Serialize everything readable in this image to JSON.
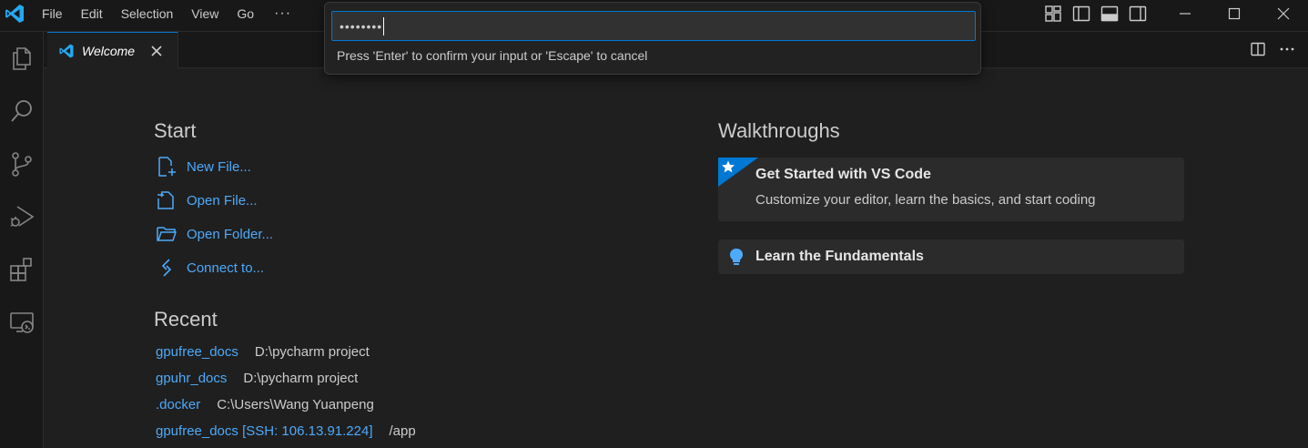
{
  "menu": {
    "items": [
      "File",
      "Edit",
      "Selection",
      "View",
      "Go"
    ],
    "more": "···"
  },
  "tab": {
    "label": "Welcome"
  },
  "quick_input": {
    "masked_value": "••••••••",
    "message": "Press 'Enter' to confirm your input or 'Escape' to cancel"
  },
  "start": {
    "title": "Start",
    "items": [
      {
        "label": "New File...",
        "icon": "new-file-icon"
      },
      {
        "label": "Open File...",
        "icon": "open-file-icon"
      },
      {
        "label": "Open Folder...",
        "icon": "open-folder-icon"
      },
      {
        "label": "Connect to...",
        "icon": "remote-connect-icon"
      }
    ]
  },
  "recent": {
    "title": "Recent",
    "items": [
      {
        "name": "gpufree_docs",
        "path": "D:\\pycharm project"
      },
      {
        "name": "gpuhr_docs",
        "path": "D:\\pycharm project"
      },
      {
        "name": ".docker",
        "path": "C:\\Users\\Wang Yuanpeng"
      },
      {
        "name": "gpufree_docs [SSH: 106.13.91.224]",
        "path": "/app"
      }
    ]
  },
  "walkthroughs": {
    "title": "Walkthroughs",
    "items": [
      {
        "title": "Get Started with VS Code",
        "description": "Customize your editor, learn the basics, and start coding"
      },
      {
        "title": "Learn the Fundamentals"
      }
    ]
  },
  "colors": {
    "accent": "#0078d4",
    "link": "#4daafc",
    "background": "#1f1f1f",
    "chrome": "#181818"
  }
}
